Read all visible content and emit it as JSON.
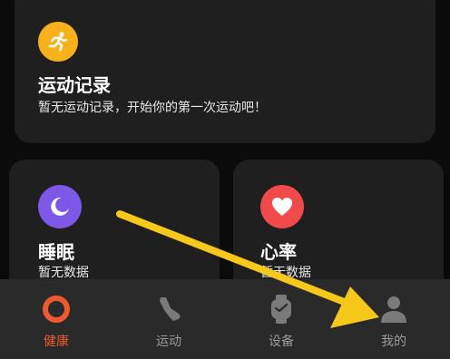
{
  "exercise_card": {
    "title": "运动记录",
    "subtitle": "暂无运动记录，开始你的第一次运动吧！",
    "icon": "running-icon"
  },
  "sleep_card": {
    "title": "睡眠",
    "subtitle": "暂无数据",
    "icon": "moon-icon"
  },
  "heart_card": {
    "title": "心率",
    "subtitle": "暂无数据",
    "icon": "heart-icon"
  },
  "bottom_nav": {
    "items": [
      {
        "label": "健康",
        "icon": "ring-icon",
        "active": true
      },
      {
        "label": "运动",
        "icon": "shoe-icon",
        "active": false
      },
      {
        "label": "设备",
        "icon": "watch-icon",
        "active": false
      },
      {
        "label": "我的",
        "icon": "person-icon",
        "active": false
      }
    ]
  },
  "colors": {
    "background": "#0b0b0b",
    "card": "#1f1f1f",
    "nav_bar": "#2a2a2a",
    "accent": "#ee5a2f",
    "exercise_icon": "#f7b21b",
    "sleep_icon": "#7d58e8",
    "heart_icon": "#f04a4b",
    "annotation_arrow": "#f6c81b"
  }
}
